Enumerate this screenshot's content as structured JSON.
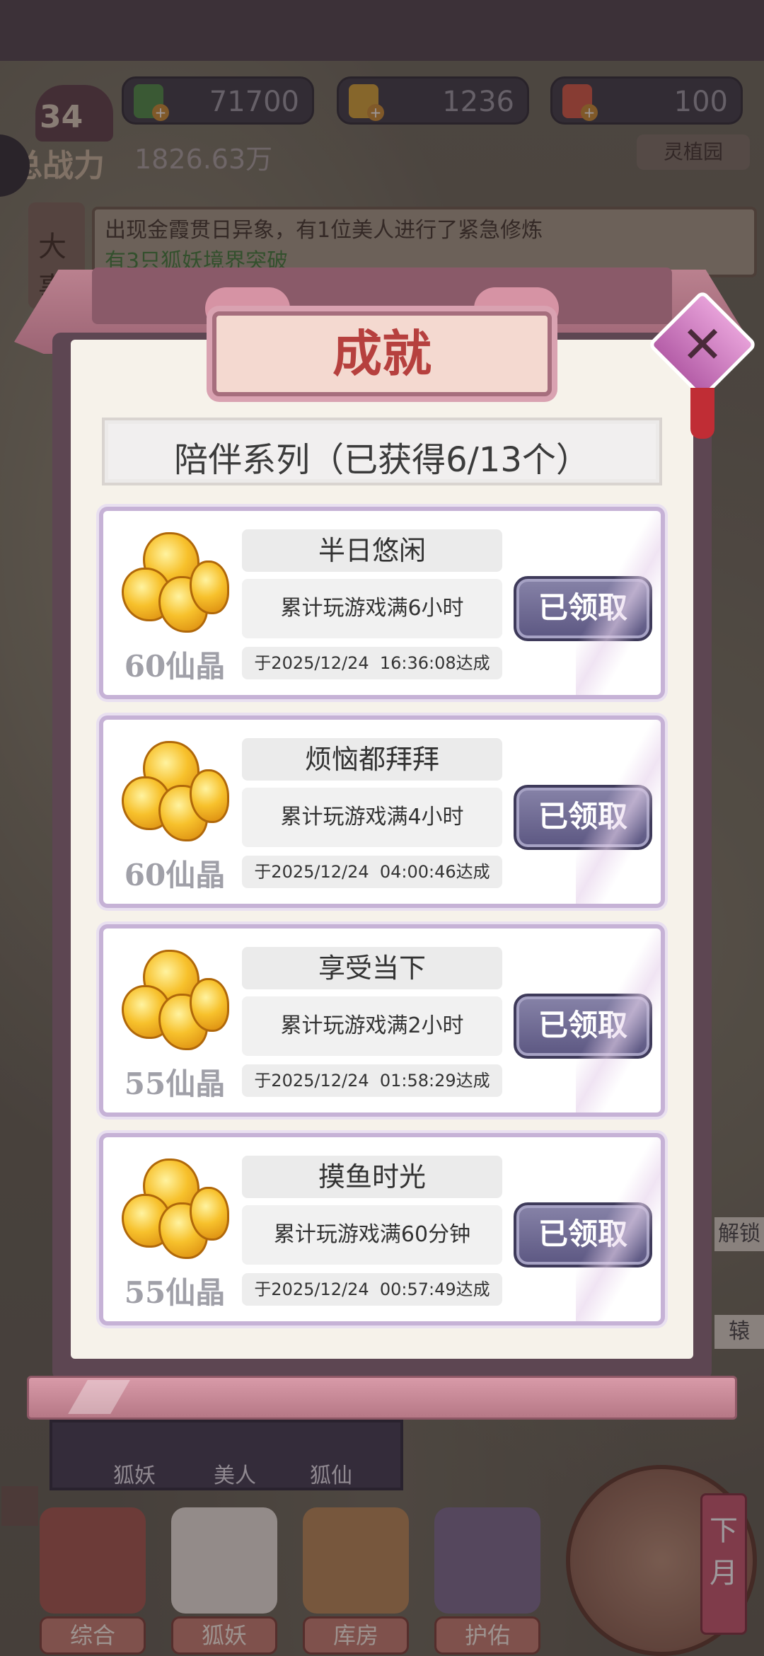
{
  "resources": [
    {
      "name": "green-gem",
      "value": "71700",
      "color": "#4a8b42"
    },
    {
      "name": "gold-ingot",
      "value": "1236",
      "color": "#d4a332"
    },
    {
      "name": "peach",
      "value": "100",
      "color": "#d65640"
    }
  ],
  "player": {
    "level": "34",
    "power_label": "总战力",
    "power_value": "1826.63万"
  },
  "garden_button": "灵植园",
  "news": {
    "side_label": "大事",
    "line1": "出现金霞贯日异象，有1位美人进行了紧急修炼",
    "line2": "有3只狐妖境界突破"
  },
  "modal": {
    "title": "成就",
    "series_header": "陪伴系列（已获得6/13个）",
    "achievements": [
      {
        "name": "半日悠闲",
        "desc": "累计玩游戏满6小时",
        "date": "于2025/12/24  16:36:08达成",
        "reward": "60仙晶",
        "status": "已领取"
      },
      {
        "name": "烦恼都拜拜",
        "desc": "累计玩游戏满4小时",
        "date": "于2025/12/24  04:00:46达成",
        "reward": "60仙晶",
        "status": "已领取"
      },
      {
        "name": "享受当下",
        "desc": "累计玩游戏满2小时",
        "date": "于2025/12/24  01:58:29达成",
        "reward": "55仙晶",
        "status": "已领取"
      },
      {
        "name": "摸鱼时光",
        "desc": "累计玩游戏满60分钟",
        "date": "于2025/12/24  00:57:49达成",
        "reward": "55仙晶",
        "status": "已领取"
      }
    ]
  },
  "subtabs": [
    "狐妖",
    "美人",
    "狐仙"
  ],
  "right_peek": [
    "解锁",
    "辕"
  ],
  "bottom_nav": [
    "综合",
    "狐妖",
    "库房",
    "护佑"
  ],
  "month_tag": "下月"
}
